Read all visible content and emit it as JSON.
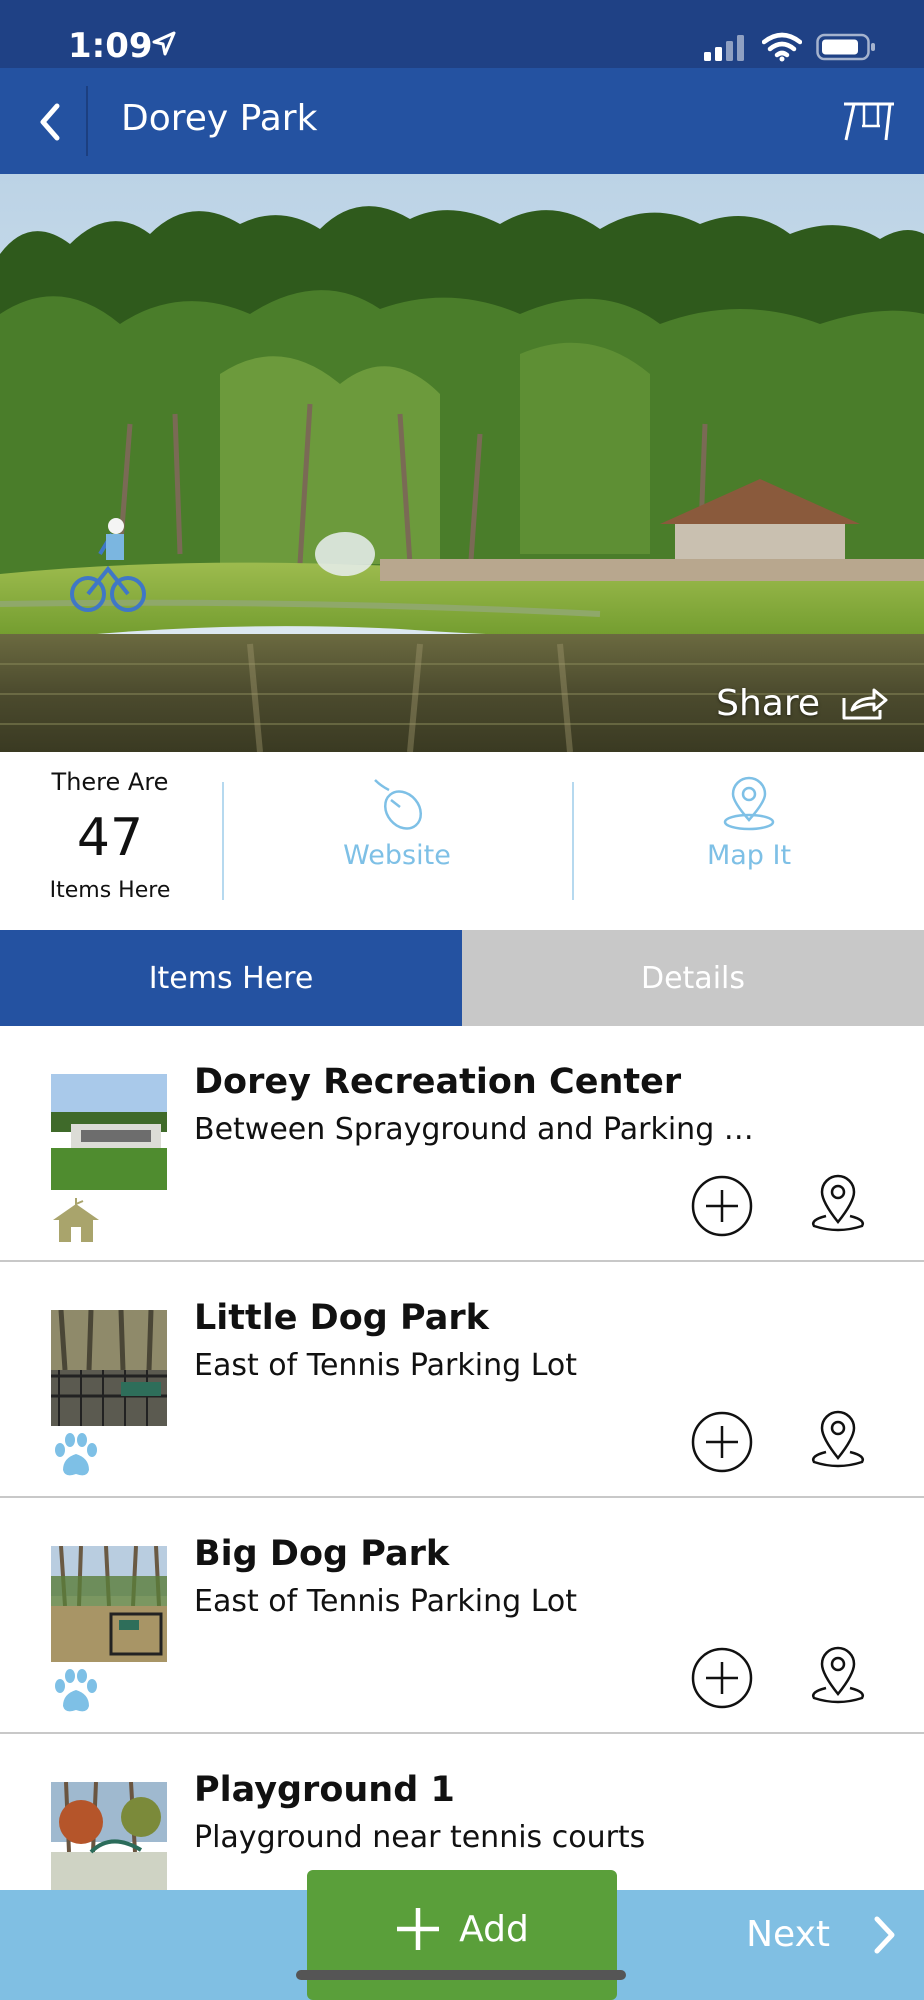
{
  "status": {
    "time": "1:09"
  },
  "nav": {
    "title": "Dorey Park"
  },
  "hero": {
    "share_label": "Share"
  },
  "info": {
    "count_top": "There Are",
    "count": "47",
    "count_bottom": "Items Here",
    "website_label": "Website",
    "map_label": "Map It"
  },
  "tabs": [
    {
      "label": "Items Here",
      "active": true
    },
    {
      "label": "Details",
      "active": false
    }
  ],
  "items": [
    {
      "title": "Dorey Recreation Center",
      "subtitle": "Between Sprayground and Parking L...",
      "category_icon": "home-icon"
    },
    {
      "title": "Little Dog Park",
      "subtitle": "East of Tennis Parking Lot",
      "category_icon": "paw-icon"
    },
    {
      "title": "Big Dog Park",
      "subtitle": "East of Tennis Parking Lot",
      "category_icon": "paw-icon"
    },
    {
      "title": "Playground 1",
      "subtitle": "Playground near tennis courts",
      "category_icon": "playground-icon"
    }
  ],
  "footer": {
    "add_label": "Add",
    "next_label": "Next"
  },
  "colors": {
    "nav": "#2452a1",
    "status": "#1f4185",
    "accent_light": "#7ec0e6",
    "add_green": "#5a9f3a",
    "bottom_bar": "#80bfe3"
  }
}
